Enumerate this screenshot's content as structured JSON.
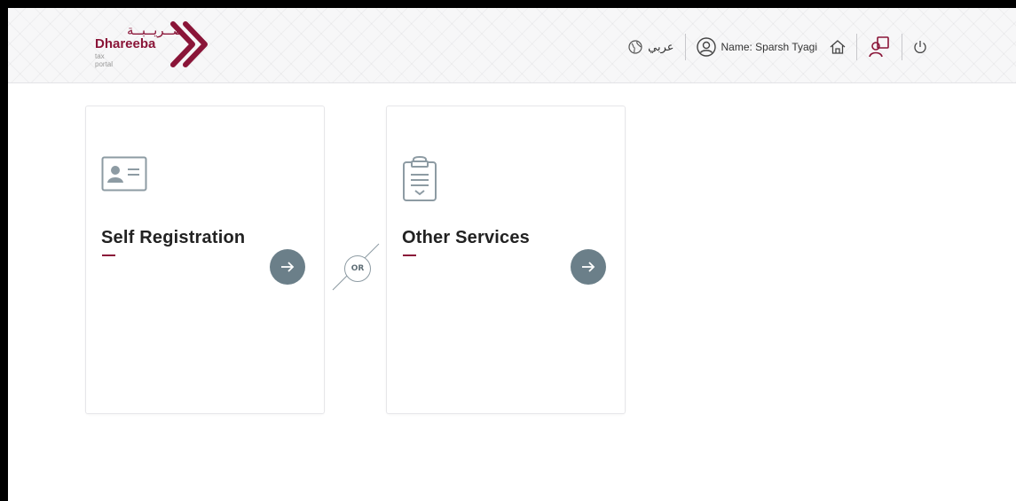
{
  "logo": {
    "arabic": "ضــريــبــة",
    "english": "Dhareeba",
    "sub": "tax portal"
  },
  "header": {
    "language_label": "عربي",
    "user_name": "Name: Sparsh Tyagi"
  },
  "cards": [
    {
      "title": "Self Registration"
    },
    {
      "title": "Other Services"
    }
  ],
  "divider_label": "OR",
  "colors": {
    "brand": "#8a1538",
    "arrow_button": "#6b7f89",
    "icon_gray": "#8d9ba3"
  },
  "icons": {
    "globe": "globe-icon",
    "user": "user-circle-icon",
    "home": "home-icon",
    "profile_switch": "profile-switch-icon",
    "power": "power-icon",
    "id_card": "id-card-icon",
    "clipboard": "clipboard-icon",
    "arrow": "arrow-right-icon"
  }
}
